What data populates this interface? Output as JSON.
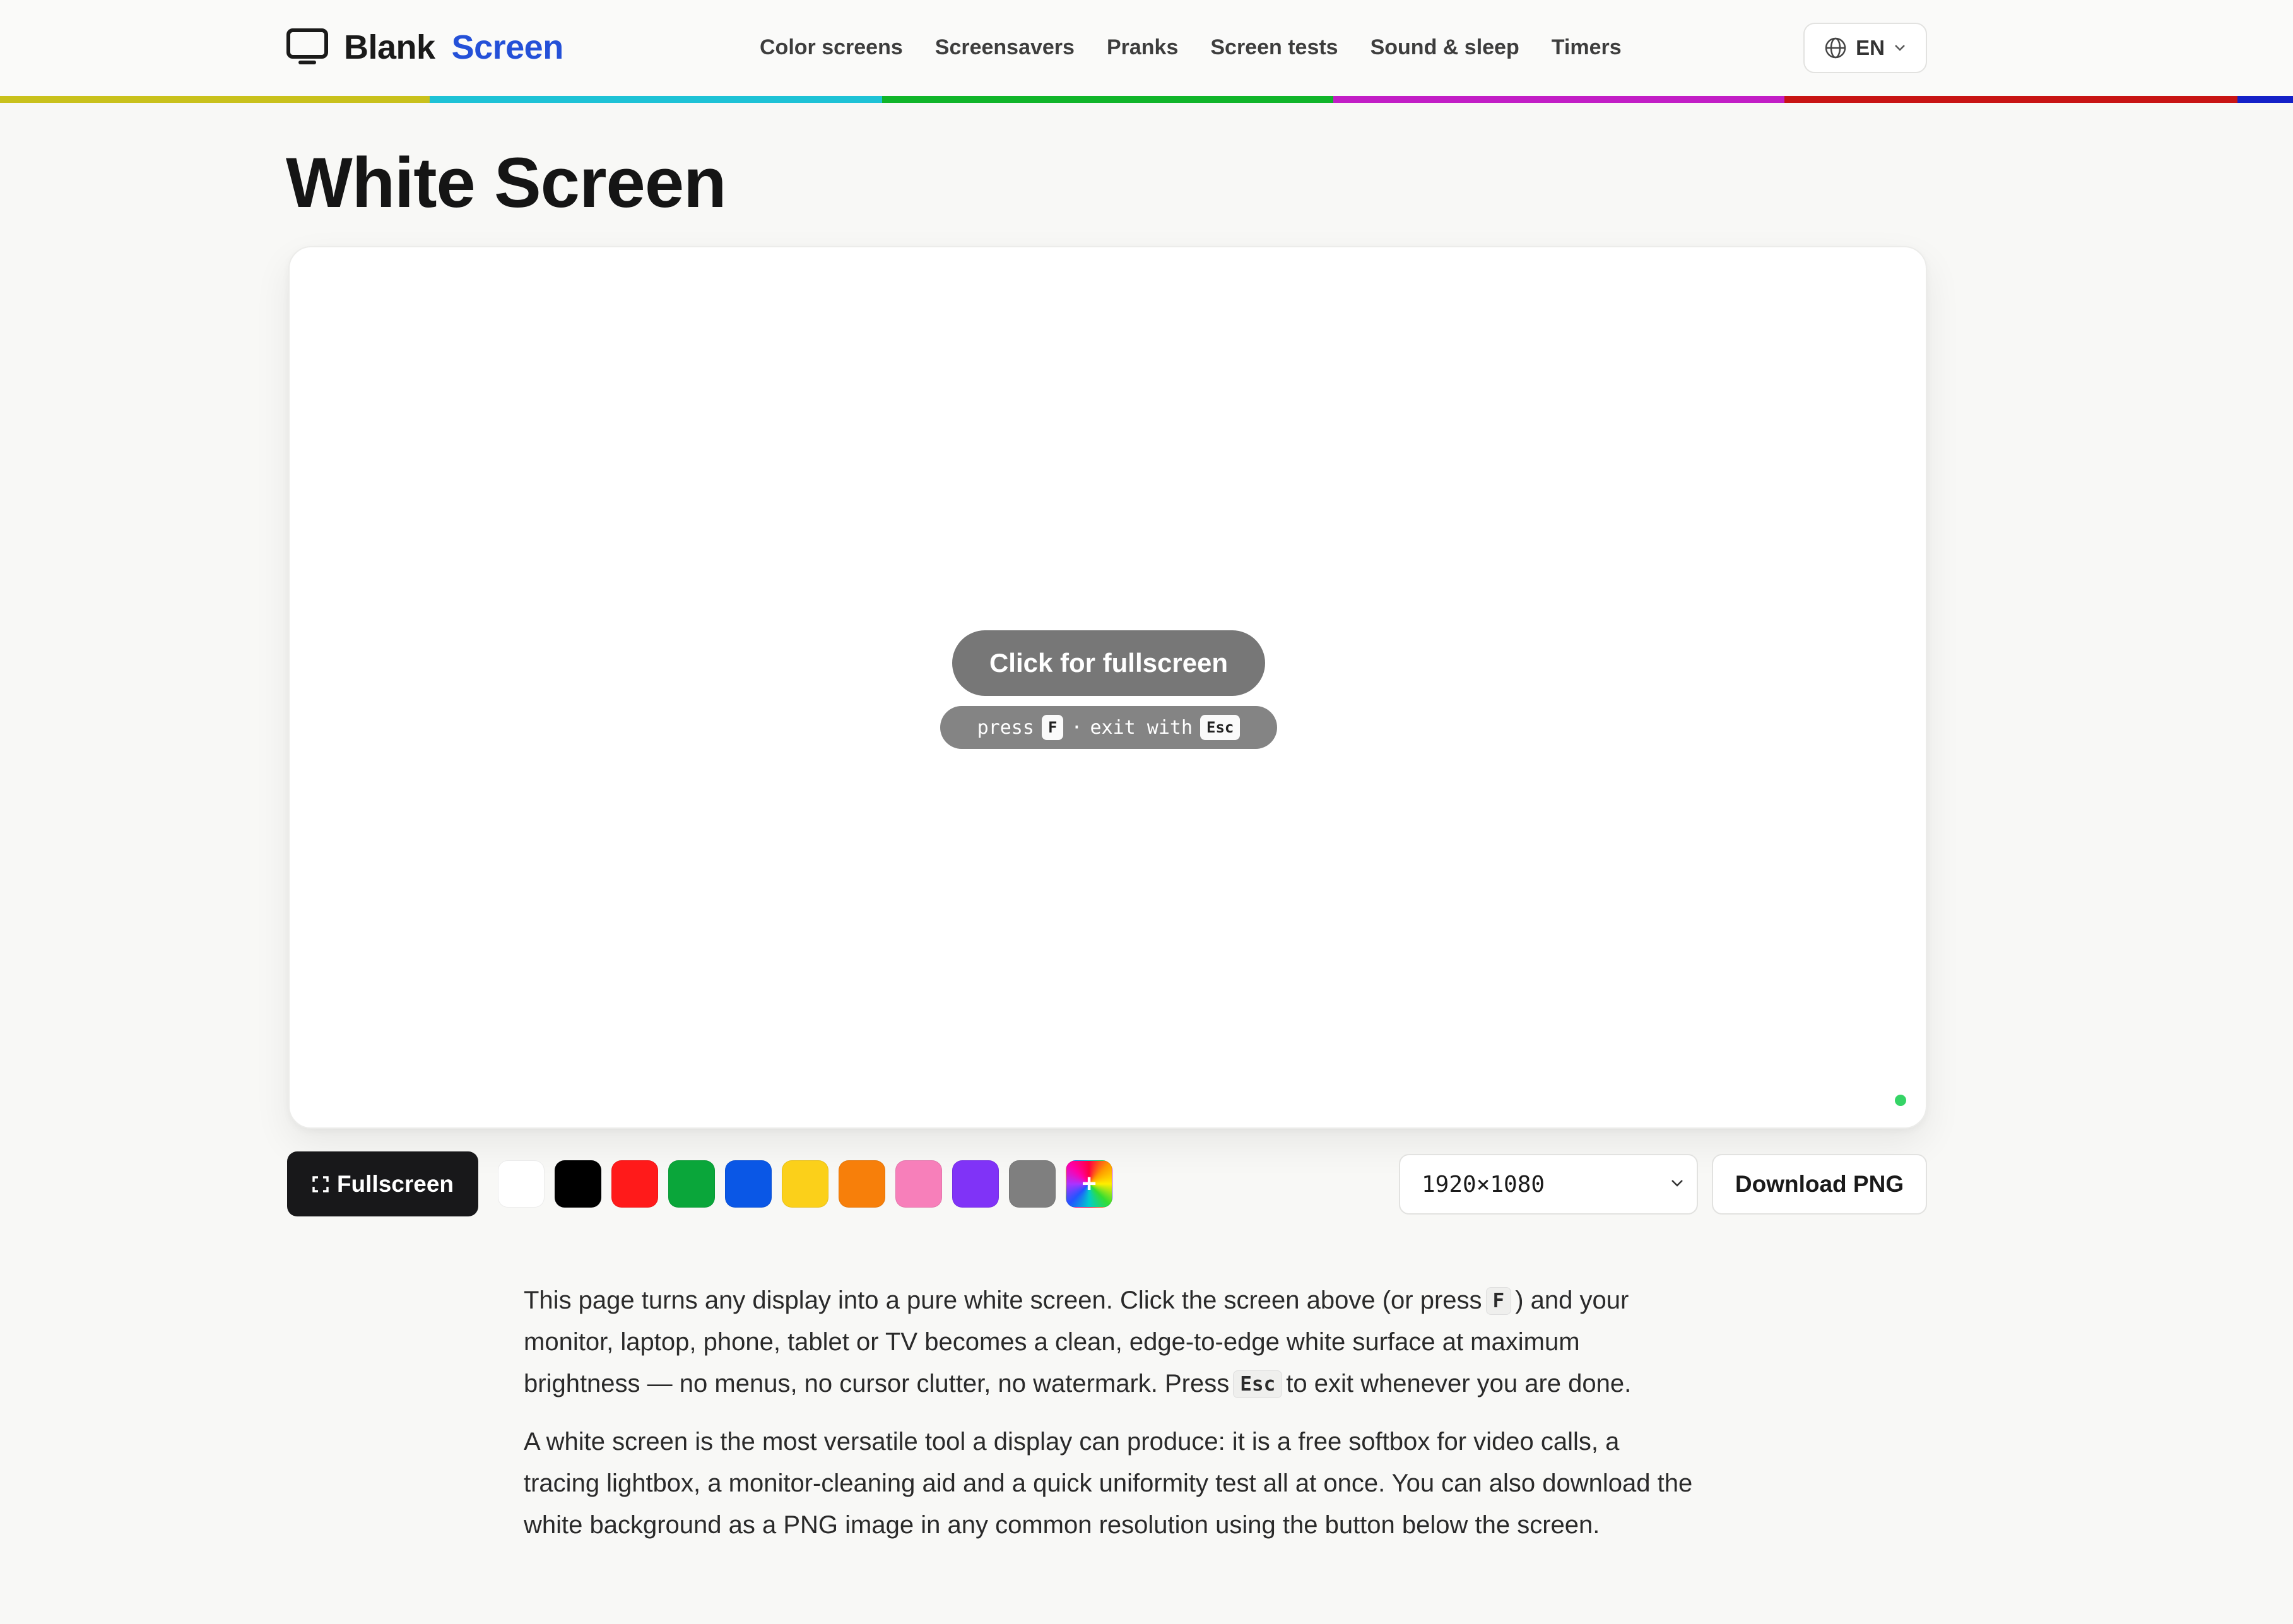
{
  "header": {
    "logo_word1": "Blank",
    "logo_word2": "Screen",
    "nav": [
      "Color screens",
      "Screensavers",
      "Pranks",
      "Screen tests",
      "Sound & sleep",
      "Timers"
    ],
    "language": "EN"
  },
  "colors": {
    "brand": "#2450d8",
    "rainbow_bar": [
      "#c9c11c",
      "#1ec2d6",
      "#10b52a",
      "#c21ec6",
      "#c81414",
      "#1421c8"
    ]
  },
  "page": {
    "title": "White Screen"
  },
  "preview": {
    "cta": "Click for fullscreen",
    "hint_press": "press",
    "hint_key_f": "F",
    "hint_sep": "·",
    "hint_exit": "exit with",
    "hint_key_esc": "Esc",
    "status_color": "#35d466"
  },
  "toolbar": {
    "fullscreen_label": "Fullscreen",
    "fullscreen_icon": "expand-corners-icon",
    "swatches": [
      {
        "name": "white",
        "color": "#ffffff"
      },
      {
        "name": "black",
        "color": "#000000"
      },
      {
        "name": "red",
        "color": "#ff1a1a"
      },
      {
        "name": "green",
        "color": "#0aa63a"
      },
      {
        "name": "blue",
        "color": "#0a57e6"
      },
      {
        "name": "yellow",
        "color": "#fbd01a"
      },
      {
        "name": "orange",
        "color": "#f77f0a"
      },
      {
        "name": "pink",
        "color": "#f77fba"
      },
      {
        "name": "purple",
        "color": "#8033f7"
      },
      {
        "name": "gray",
        "color": "#7f7f7f"
      },
      {
        "name": "custom",
        "color": "rainbow"
      }
    ],
    "custom_swatch_symbol": "+",
    "resolution": "1920×1080",
    "download_label": "Download PNG"
  },
  "content": {
    "p1_a": "This page turns any display into a pure white screen. Click the screen above (or press",
    "p1_key": "F",
    "p1_b": ") and your monitor, laptop, phone, tablet or TV becomes a clean, edge-to-edge white surface at maximum brightness — no menus, no cursor clutter, no watermark. Press",
    "p1_key2": "Esc",
    "p1_c": "to exit whenever you are done.",
    "p2": "A white screen is the most versatile tool a display can produce: it is a free softbox for video calls, a tracing lightbox, a monitor-cleaning aid and a quick uniformity test all at once. You can also download the white background as a PNG image in any common resolution using the button below the screen."
  }
}
